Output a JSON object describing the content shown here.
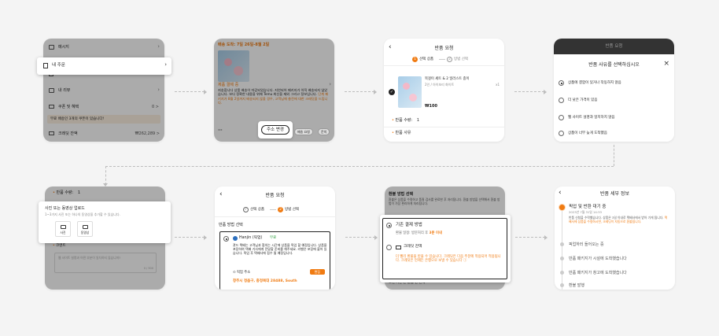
{
  "s1": {
    "menu": [
      "메시지",
      "내 주문",
      "내 리뷰",
      "쿠폰 및 혜택"
    ],
    "coupon_count": "0 >",
    "coupon_notice": "무료 배송인 3개의 쿠폰이 있습니다!",
    "credit_label": "크레딧 잔액",
    "credit_value": "₩262,289 >"
  },
  "s2": {
    "delivery": "배송 도착: 7일 26일-8월 2일",
    "item_label": "제품 결제 중",
    "body": "죄송합니다 상품 배송이 마감되었습니다. 지연되어 패키지가 아직 배송되지 않았습니다. 보다 정확한 내용을 위해 Temu 최신을 제외 그리고 정보입니다.",
    "body_orange": "단계 패키지가 8월 2일까지 배송되지 않을 경우, 고객님께 충전에 대한 크레딧을 드립니다.",
    "dots": "···",
    "btn_address": "주소 변경",
    "btn_other1": "배송 요청",
    "btn_other2": "문의"
  },
  "s3": {
    "title": "반품 요청",
    "step1": "선택 상품",
    "step2": "방법 선택",
    "product_name": "목걸이 세트 & 2 일러스트 종이",
    "product_sub": "2인 / 아이보리 화이트",
    "qty_x": "x1",
    "price": "₩100",
    "qty_label": "반품 수량:",
    "qty_value": "1",
    "reason_label": "반품 사유"
  },
  "s4": {
    "top_title": "반품 요청",
    "sheet_title": "반품 사유를 선택하십시오",
    "close": "×",
    "options": [
      "상품에 결함이 있거나 작동하지 않음",
      "더 낮은 가격이 있음",
      "웹 사이트 설명과 일치하지 않음",
      "상품이 너무 늦게 도착했음"
    ]
  },
  "s5": {
    "qty_label": "반품 수량:",
    "qty_value": "1",
    "upload_title": "사진 또는 동영상 업로드",
    "upload_hint": "1~3가지 사진 또는 하나의 동영상을 추가할 수 있습니다.",
    "photo": "사진",
    "video": "동영상",
    "comment_label": "코멘트",
    "comment_placeholder": "웹 사이트 설명과 어떤 부분이 일치하지 않습니까?",
    "counter": "0 / 500"
  },
  "s6": {
    "title": "반품 요청",
    "step1": "선택 상품",
    "step2": "방법 선택",
    "section": "반품 방법 선택",
    "carrier": "Hanjin (픽업)",
    "free": "무료",
    "desc": "관드 택배는 고객님과 협의는 시간에 상품을 픽업 할 예정입니다. 상품을 포장하여 택배 기사에게 전달할 준비를 해주세요. 라벨은 포장에 붙어 있습니다. 픽업 후 택배사에 접수 될 예정입니다.",
    "pickup_label": "픽업 주소",
    "edit_btn": "편집",
    "address": "창주시 정읍구, 충정북대 28488, South"
  },
  "s7": {
    "title": "환불 방법 선택",
    "desc": "환불은 상품을 수령하고 품질 검사를 완료한 후 처리됩니다. 환불 방법을 선택해서 환불 방법이 가장 편리하게 처리됩니다.",
    "opt1": "기존 결제 방법",
    "opt1_sub1": "환불 일정: 방문처리 후",
    "opt1_sub2": "3분 이내",
    "opt2": "크레딧 잔액",
    "note": "더 빨리 환불을 받을 수 있습니다. 크레딧은 다음 주문에 적용되어 적용됩니다. 크레딧은 언제든 은행으로 보낼 수 있습니다 ⓘ",
    "bottom": "보낸 기한 안 받음 번 선택"
  },
  "s8": {
    "title": "반품 세부 정보",
    "step1_title": "픽업 및 반환 대기 중",
    "step1_date": "2023년 7월 31일 14:33",
    "step1_text": "반품 신청을 수락했습니다. 상품은 3일 이내로 택배사에서 받아 가게 됩니다.",
    "step1_orange": "택배사에 상품을 수령하시면, 크레딧이 자동으로 환불됩니다.",
    "steps": [
      "픽업하러 들어오는 중",
      "반품 패키지가 시설에 도착했습니다",
      "반품 패키지가 창고에 도착했습니다",
      "환불 발행"
    ]
  }
}
